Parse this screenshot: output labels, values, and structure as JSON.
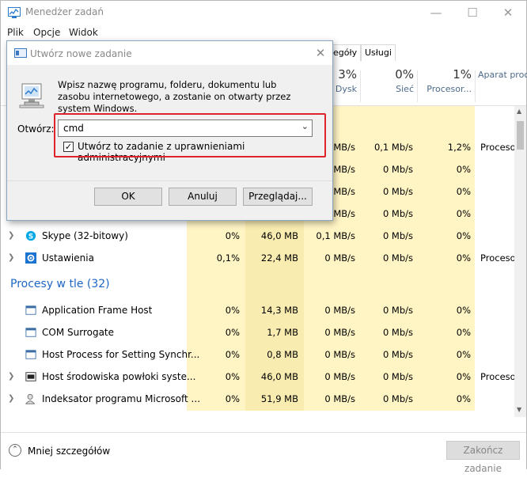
{
  "window": {
    "title": "Menedżer zadań",
    "controls": {
      "minimize": "—",
      "maximize": "☐",
      "close": "✕"
    }
  },
  "menu": [
    "Plik",
    "Opcje",
    "Widok"
  ],
  "tabs_visible": [
    "egóły",
    "Usługi"
  ],
  "columns": [
    {
      "pct": "3%",
      "label": "Dysk"
    },
    {
      "pct": "0%",
      "label": "Sieć"
    },
    {
      "pct": "1%",
      "label": "Procesor..."
    },
    {
      "pct": "",
      "label": "Aparat proc"
    }
  ],
  "rows_top": [
    {
      "cpu": "",
      "mem": "",
      "disk": "MB/s",
      "net": "0,1 Mb/s",
      "gpu": "1,2%",
      "engine": "Proceso"
    },
    {
      "cpu": "",
      "mem": "",
      "disk": "MB/s",
      "net": "0 Mb/s",
      "gpu": "0%",
      "engine": ""
    },
    {
      "cpu": "",
      "mem": "",
      "disk": "MB/s",
      "net": "0 Mb/s",
      "gpu": "0%",
      "engine": ""
    },
    {
      "cpu": "",
      "mem": "",
      "disk": "MB/s",
      "net": "0 Mb/s",
      "gpu": "0%",
      "engine": ""
    }
  ],
  "apps": [
    {
      "name": "Skype (32-bitowy)",
      "icon": "skype-icon",
      "cpu": "0%",
      "mem": "46,0 MB",
      "disk": "0,1 MB/s",
      "net": "0 Mb/s",
      "gpu": "0%",
      "engine": ""
    },
    {
      "name": "Ustawienia",
      "icon": "settings-gear-icon",
      "cpu": "0,1%",
      "mem": "22,4 MB",
      "disk": "0 MB/s",
      "net": "0 Mb/s",
      "gpu": "0%",
      "engine": "Proceso"
    }
  ],
  "background_group": "Procesy w tle (32)",
  "background": [
    {
      "name": "Application Frame Host",
      "expand": false,
      "cpu": "0%",
      "mem": "14,3 MB",
      "disk": "0 MB/s",
      "net": "0 Mb/s",
      "gpu": "0%",
      "engine": ""
    },
    {
      "name": "COM Surrogate",
      "expand": false,
      "cpu": "0%",
      "mem": "1,7 MB",
      "disk": "0 MB/s",
      "net": "0 Mb/s",
      "gpu": "0%",
      "engine": ""
    },
    {
      "name": "Host Process for Setting Synchr...",
      "expand": false,
      "cpu": "0%",
      "mem": "0,8 MB",
      "disk": "0 MB/s",
      "net": "0 Mb/s",
      "gpu": "0%",
      "engine": ""
    },
    {
      "name": "Host środowiska powłoki syste...",
      "expand": true,
      "cpu": "0%",
      "mem": "46,0 MB",
      "disk": "0 MB/s",
      "net": "0 Mb/s",
      "gpu": "0%",
      "engine": "Proceso"
    },
    {
      "name": "Indeksator programu Microsoft ...",
      "expand": true,
      "cpu": "0%",
      "mem": "51,9 MB",
      "disk": "0 MB/s",
      "net": "0 Mb/s",
      "gpu": "0%",
      "engine": ""
    }
  ],
  "footer": {
    "less_details": "Mniej szczegółów",
    "end_task": "Zakończ zadanie"
  },
  "dialog": {
    "title": "Utwórz nowe zadanie",
    "description": "Wpisz nazwę programu, folderu, dokumentu lub zasobu internetowego, a zostanie on otwarty przez system Windows.",
    "open_label": "Otwórz:",
    "command_value": "cmd",
    "admin_checkbox_label": "Utwórz to zadanie z uprawnieniami administracyjnymi",
    "admin_checked": true,
    "buttons": {
      "ok": "OK",
      "cancel": "Anuluj",
      "browse": "Przeglądaj..."
    }
  },
  "colors": {
    "heat_light": "#fff4c4",
    "heat_medium": "#f9ecb0",
    "highlight_red": "#e0232a",
    "link_blue": "#1e66c5"
  }
}
